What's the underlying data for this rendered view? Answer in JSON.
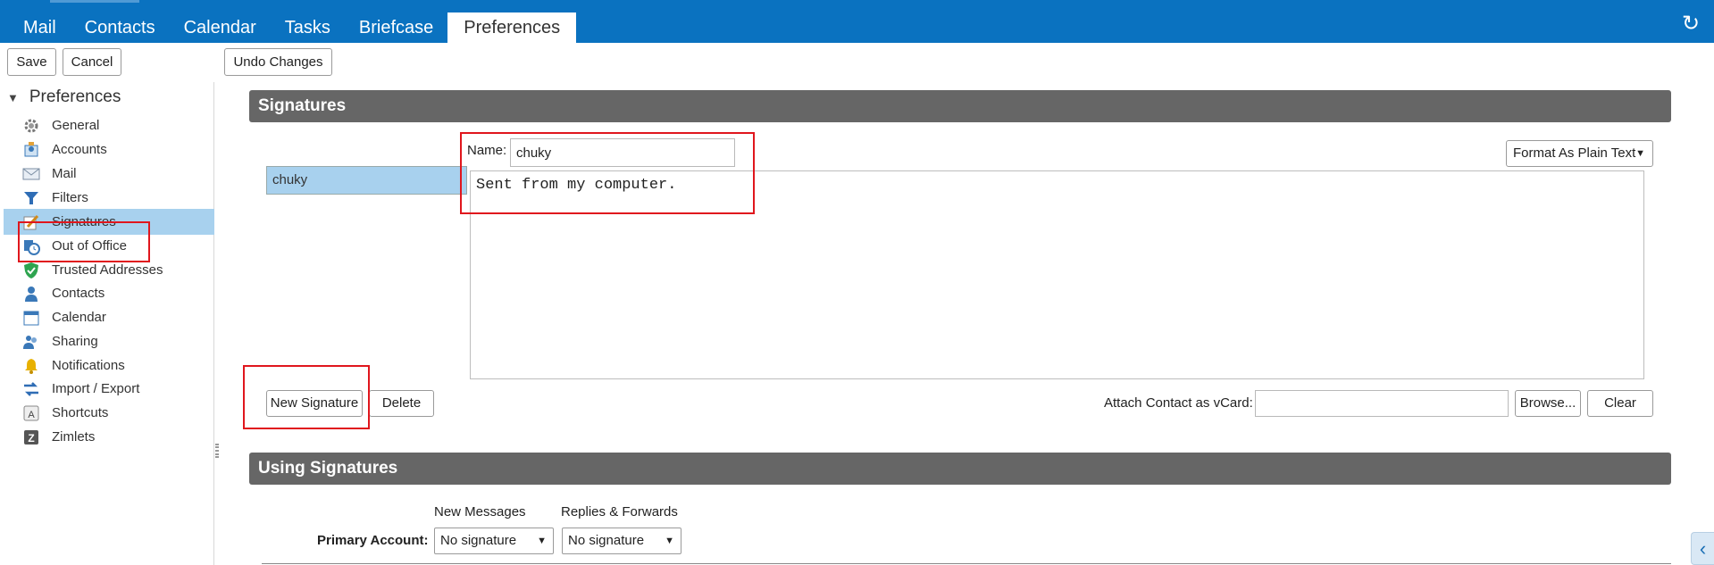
{
  "nav": {
    "tabs": [
      {
        "label": "Mail"
      },
      {
        "label": "Contacts"
      },
      {
        "label": "Calendar"
      },
      {
        "label": "Tasks"
      },
      {
        "label": "Briefcase"
      },
      {
        "label": "Preferences"
      }
    ],
    "active_tab": "Preferences",
    "refresh_icon": "refresh-icon",
    "brand_color": "#0a72c0"
  },
  "toolbar": {
    "save_label": "Save",
    "cancel_label": "Cancel",
    "undo_label": "Undo Changes"
  },
  "sidebar": {
    "header": "Preferences",
    "items": [
      {
        "label": "General",
        "icon": "gear-icon"
      },
      {
        "label": "Accounts",
        "icon": "accounts-icon"
      },
      {
        "label": "Mail",
        "icon": "mail-icon"
      },
      {
        "label": "Filters",
        "icon": "filter-icon"
      },
      {
        "label": "Signatures",
        "icon": "signature-icon",
        "active": true
      },
      {
        "label": "Out of Office",
        "icon": "out-of-office-icon"
      },
      {
        "label": "Trusted Addresses",
        "icon": "shield-icon"
      },
      {
        "label": "Contacts",
        "icon": "contacts-icon"
      },
      {
        "label": "Calendar",
        "icon": "calendar-icon"
      },
      {
        "label": "Sharing",
        "icon": "sharing-icon"
      },
      {
        "label": "Notifications",
        "icon": "bell-icon"
      },
      {
        "label": "Import / Export",
        "icon": "import-export-icon"
      },
      {
        "label": "Shortcuts",
        "icon": "shortcuts-icon"
      },
      {
        "label": "Zimlets",
        "icon": "zimlets-icon"
      }
    ]
  },
  "signatures": {
    "section_title": "Signatures",
    "list": [
      "chuky"
    ],
    "name_label": "Name:",
    "name_value": "chuky",
    "format_select": "Format As Plain Text",
    "body": "Sent from my computer.",
    "new_signature_label": "New Signature",
    "delete_label": "Delete",
    "vcard_label": "Attach Contact as vCard:",
    "vcard_value": "",
    "browse_label": "Browse...",
    "clear_label": "Clear"
  },
  "using_signatures": {
    "section_title": "Using Signatures",
    "col_new_messages": "New Messages",
    "col_replies": "Replies & Forwards",
    "primary_account_label": "Primary Account:",
    "new_messages_value": "No signature",
    "replies_value": "No signature"
  },
  "colors": {
    "selected_bg": "#a8d1ee",
    "section_bar": "#666666",
    "annotation_red": "#e0161d"
  }
}
